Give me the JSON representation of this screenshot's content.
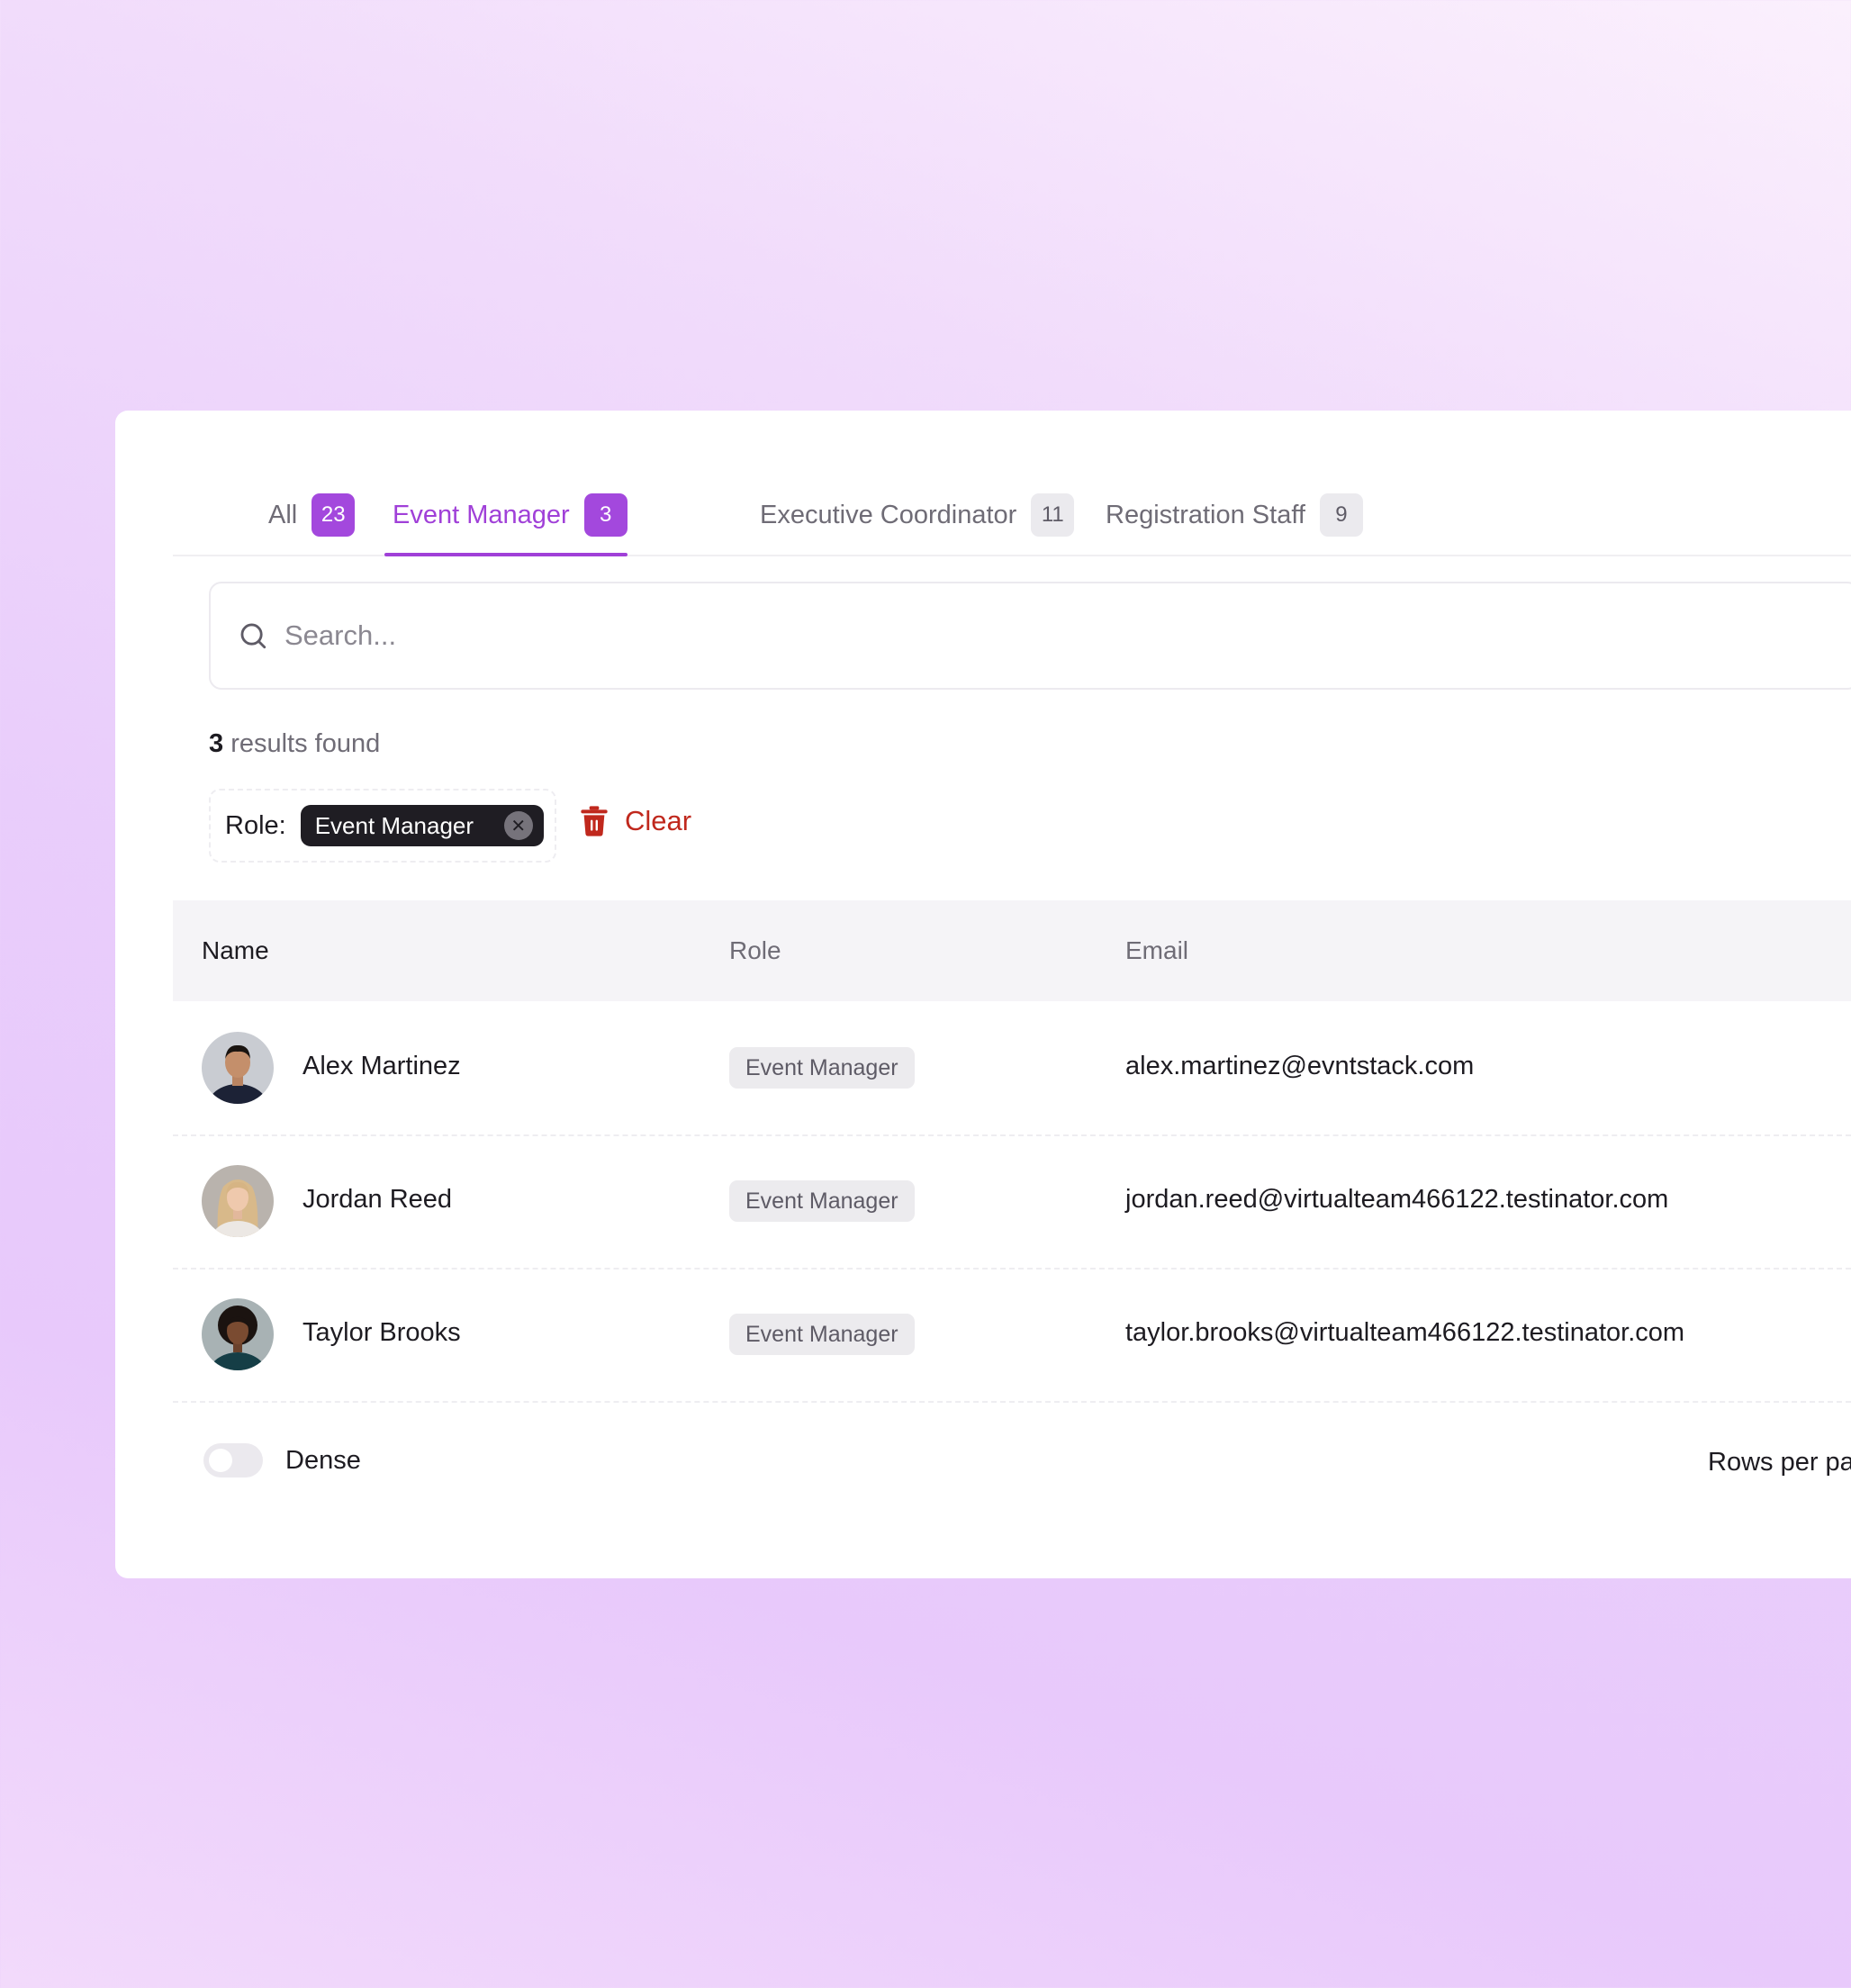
{
  "tabs": [
    {
      "label": "All",
      "count": "23"
    },
    {
      "label": "Event Manager",
      "count": "3"
    },
    {
      "label": "Executive Coordinator",
      "count": "11"
    },
    {
      "label": "Registration Staff",
      "count": "9"
    }
  ],
  "active_tab": "Event Manager",
  "search": {
    "placeholder": "Search...",
    "value": ""
  },
  "results": {
    "count": "3",
    "suffix": " results found"
  },
  "filter": {
    "label": "Role:",
    "chip": "Event Manager",
    "clear_label": "Clear"
  },
  "table": {
    "headers": {
      "name": "Name",
      "role": "Role",
      "email": "Email"
    },
    "rows": [
      {
        "name": "Alex Martinez",
        "role": "Event Manager",
        "email": "alex.martinez@evntstack.com"
      },
      {
        "name": "Jordan Reed",
        "role": "Event Manager",
        "email": "jordan.reed@virtualteam466122.testinator.com"
      },
      {
        "name": "Taylor Brooks",
        "role": "Event Manager",
        "email": "taylor.brooks@virtualteam466122.testinator.com"
      }
    ]
  },
  "footer": {
    "dense_label": "Dense",
    "dense_on": false,
    "rows_per_page_label": "Rows per pa"
  },
  "colors": {
    "accent": "#a040d8",
    "danger": "#c0281d",
    "chip_bg": "#1f1d23"
  }
}
